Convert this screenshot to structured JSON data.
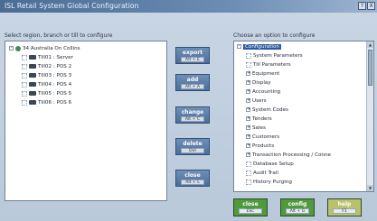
{
  "window": {
    "title": "ISL Retail System Global Configuration",
    "help_btn": "?",
    "close_btn": "X"
  },
  "left": {
    "label": "Select region, branch or till to configure",
    "tree": [
      {
        "label": "34 Australia On Collins",
        "level": 0,
        "kind": "store",
        "expander": "-"
      },
      {
        "label": "Till01 : Server",
        "level": 1,
        "kind": "till"
      },
      {
        "label": "Till02 : POS 2",
        "level": 1,
        "kind": "till"
      },
      {
        "label": "Till03 : POS 3",
        "level": 1,
        "kind": "till"
      },
      {
        "label": "Till04 : POS 4",
        "level": 1,
        "kind": "till"
      },
      {
        "label": "Till05 : POS 5",
        "level": 1,
        "kind": "till"
      },
      {
        "label": "Till06 : POS 6",
        "level": 1,
        "kind": "till"
      }
    ]
  },
  "mid_buttons": [
    {
      "label": "export",
      "shortcut": "Alt + E"
    },
    {
      "label": "add",
      "shortcut": "Alt + A"
    },
    {
      "label": "change",
      "shortcut": "Alt + C"
    },
    {
      "label": "delete",
      "shortcut": "Del"
    },
    {
      "label": "close",
      "shortcut": "Alt + L"
    }
  ],
  "right": {
    "label": "Choose an option to configure",
    "tree": [
      {
        "label": "Configuration",
        "level": 0,
        "expander": "-",
        "selected": true
      },
      {
        "label": "System Parameters",
        "level": 1,
        "expander": ""
      },
      {
        "label": "Till Parameters",
        "level": 1,
        "expander": ""
      },
      {
        "label": "Equipment",
        "level": 1,
        "expander": "+"
      },
      {
        "label": "Display",
        "level": 1,
        "expander": "+"
      },
      {
        "label": "Accounting",
        "level": 1,
        "expander": "+"
      },
      {
        "label": "Users",
        "level": 1,
        "expander": "+"
      },
      {
        "label": "System Codes",
        "level": 1,
        "expander": "+"
      },
      {
        "label": "Tenders",
        "level": 1,
        "expander": "+"
      },
      {
        "label": "Sales",
        "level": 1,
        "expander": "+"
      },
      {
        "label": "Customers",
        "level": 1,
        "expander": "+"
      },
      {
        "label": "Products",
        "level": 1,
        "expander": "+"
      },
      {
        "label": "Transaction Processing / Conne",
        "level": 1,
        "expander": "+"
      },
      {
        "label": "Database Setup",
        "level": 1,
        "expander": ""
      },
      {
        "label": "Audit Trail",
        "level": 1,
        "expander": ""
      },
      {
        "label": "History Purging",
        "level": 1,
        "expander": ""
      }
    ]
  },
  "bottom_buttons": [
    {
      "label": "close",
      "shortcut": "ESC",
      "color": "#4e9a3c"
    },
    {
      "label": "config",
      "shortcut": "Alt + G",
      "color": "#4e9a3c"
    },
    {
      "label": "help",
      "shortcut": "F1",
      "color": "#b7c26b"
    }
  ]
}
